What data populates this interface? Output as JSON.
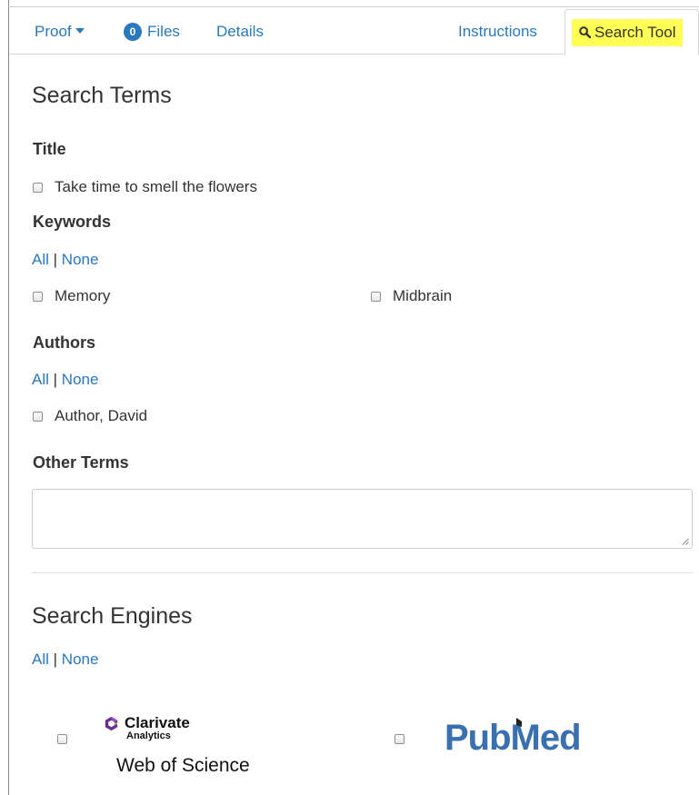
{
  "nav": {
    "proof_label": "Proof",
    "files_count": "0",
    "files_label": "Files",
    "details_label": "Details",
    "instructions_label": "Instructions",
    "search_tool_label": "Search Tool"
  },
  "search_terms": {
    "heading": "Search Terms",
    "title_label": "Title",
    "title_option": "Take time to smell the flowers",
    "keywords_label": "Keywords",
    "all_label": "All",
    "separator": "|",
    "none_label": "None",
    "keywords": [
      "Memory",
      "Midbrain"
    ],
    "authors_label": "Authors",
    "authors": [
      "Author, David"
    ],
    "other_terms_label": "Other Terms",
    "other_terms_value": ""
  },
  "search_engines": {
    "heading": "Search Engines",
    "engines": [
      {
        "brand": "Clarivate",
        "brand_sub": "Analytics",
        "name": "Web of Science"
      },
      {
        "name": "PubMed"
      }
    ]
  },
  "colors": {
    "link": "#2a78bd",
    "highlight": "#ffff55",
    "pubmed_blue": "#3a6fb0",
    "clarivate_purple": "#6a2c91",
    "clarivate_green": "#8cc63f"
  },
  "icons": [
    "caret-down-icon",
    "search-icon",
    "resize-grip-icon",
    "clarivate-logo-icon",
    "pubmed-book-icon"
  ]
}
